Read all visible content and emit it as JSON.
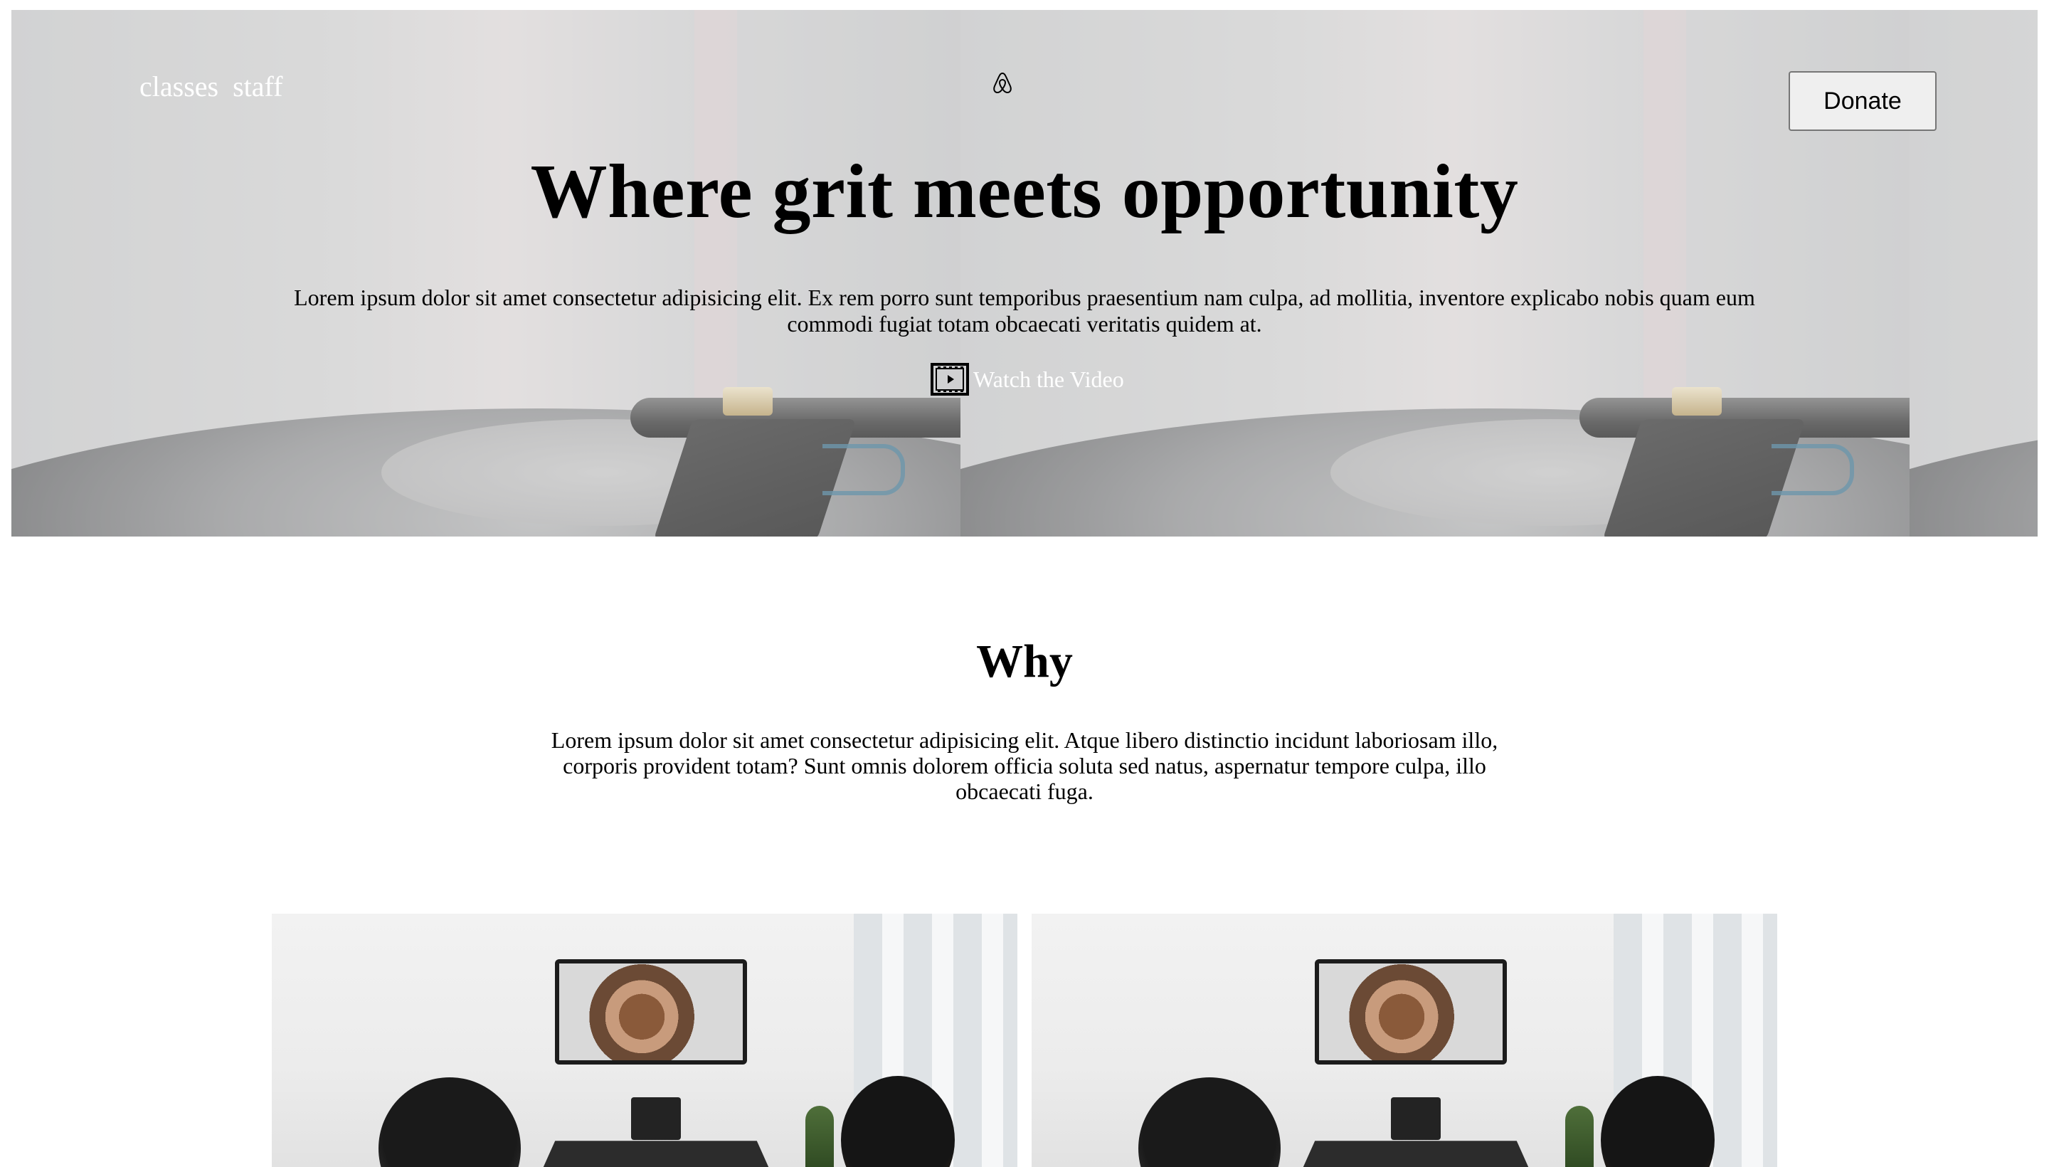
{
  "nav": {
    "links": [
      {
        "label": "classes"
      },
      {
        "label": "staff"
      }
    ],
    "brand_icon": "airbnb-logo-icon",
    "donate_label": "Donate"
  },
  "hero": {
    "title": "Where grit meets opportunity",
    "text": "Lorem ipsum dolor sit amet consectetur adipisicing elit. Ex rem porro sunt temporibus praesentium nam culpa, ad mollitia, inventore explicabo nobis quam eum commodi fugiat totam obcaecati veritatis quidem at.",
    "watch_icon": "film-play-icon",
    "watch_label": "Watch the Video"
  },
  "why": {
    "title": "Why",
    "text": "Lorem ipsum dolor sit amet consectetur adipisicing elit. Atque libero distinctio incidunt laboriosam illo, corporis provident totam? Sunt omnis dolorem officia soluta sed natus, aspernatur tempore culpa, illo obcaecati fuga."
  },
  "colors": {
    "nav_text": "#ffffff",
    "button_bg": "#efefef",
    "button_border": "#767676"
  }
}
